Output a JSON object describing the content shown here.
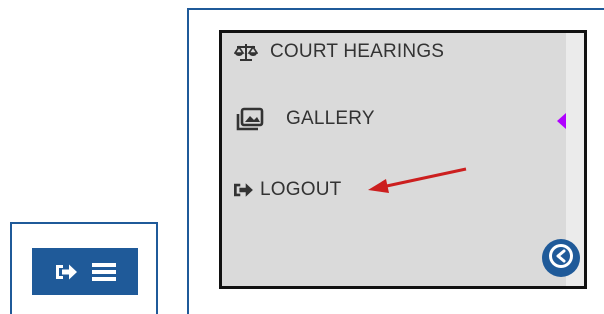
{
  "menu": {
    "items": [
      {
        "label": "COURT HEARINGS",
        "icon": "scales-icon"
      },
      {
        "label": "GALLERY",
        "icon": "gallery-icon"
      },
      {
        "label": "LOGOUT",
        "icon": "logout-icon"
      }
    ]
  },
  "colors": {
    "brand": "#1f5a99",
    "menu_bg": "#dadada",
    "annotation_arrow": "#cc1f1f",
    "active_caret": "#b000ff"
  },
  "toolbar": {
    "icons": [
      "logout-icon",
      "hamburger-menu-icon"
    ]
  },
  "back_button": {
    "icon": "arrow-left-circle-icon"
  }
}
